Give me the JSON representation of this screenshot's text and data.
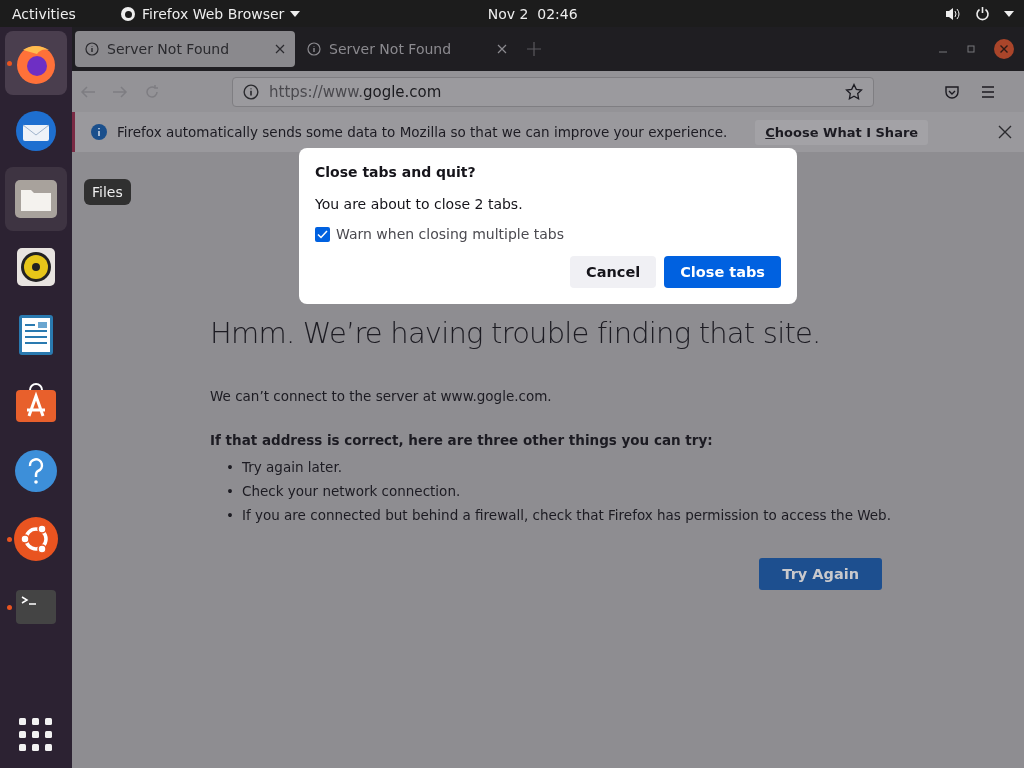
{
  "top_bar": {
    "activities": "Activities",
    "app_menu": "Firefox Web Browser",
    "clock": "Nov 2  02:46"
  },
  "dock": {
    "items": [
      {
        "kind": "firefox",
        "running": true,
        "selected": true,
        "hovered": false
      },
      {
        "kind": "mail",
        "running": false,
        "selected": false,
        "hovered": false
      },
      {
        "kind": "files",
        "running": false,
        "selected": false,
        "hovered": true,
        "tooltip": "Files"
      },
      {
        "kind": "music",
        "running": false,
        "selected": false,
        "hovered": false
      },
      {
        "kind": "writer",
        "running": false,
        "selected": false,
        "hovered": false
      },
      {
        "kind": "software",
        "running": false,
        "selected": false,
        "hovered": false
      },
      {
        "kind": "help",
        "running": false,
        "selected": false,
        "hovered": false
      },
      {
        "kind": "ubuntu",
        "running": true,
        "selected": false,
        "hovered": false
      },
      {
        "kind": "terminal",
        "running": true,
        "selected": false,
        "hovered": false
      }
    ]
  },
  "browser": {
    "tabs": [
      {
        "title": "Server Not Found",
        "selected": true
      },
      {
        "title": "Server Not Found",
        "selected": false
      }
    ],
    "url": {
      "prefix": "https://www.",
      "host": "gogle.com"
    },
    "notification": {
      "text": "Firefox automatically sends some data to Mozilla so that we can improve your experience.",
      "button": "Choose What I Share"
    },
    "error_page": {
      "title": "Hmm. We’re having trouble finding that site.",
      "description": "We can’t connect to the server at www.gogle.com.",
      "subheading": "If that address is correct, here are three other things you can try:",
      "suggestions": [
        {
          "bullet": "•",
          "text": "Try again later."
        },
        {
          "bullet": "•",
          "text": "Check your network connection."
        },
        {
          "bullet": "•",
          "text": "If you are connected but behind a firewall, check that Firefox has permission to access the Web."
        }
      ],
      "button": "Try Again"
    },
    "dialog": {
      "title": "Close tabs and quit?",
      "message": "You are about to close 2 tabs.",
      "checkbox": {
        "label": "Warn when closing multiple tabs",
        "checked": true
      },
      "buttons": [
        {
          "label": "Cancel",
          "kind": "secondary"
        },
        {
          "label": "Close tabs",
          "kind": "primary"
        }
      ]
    }
  }
}
